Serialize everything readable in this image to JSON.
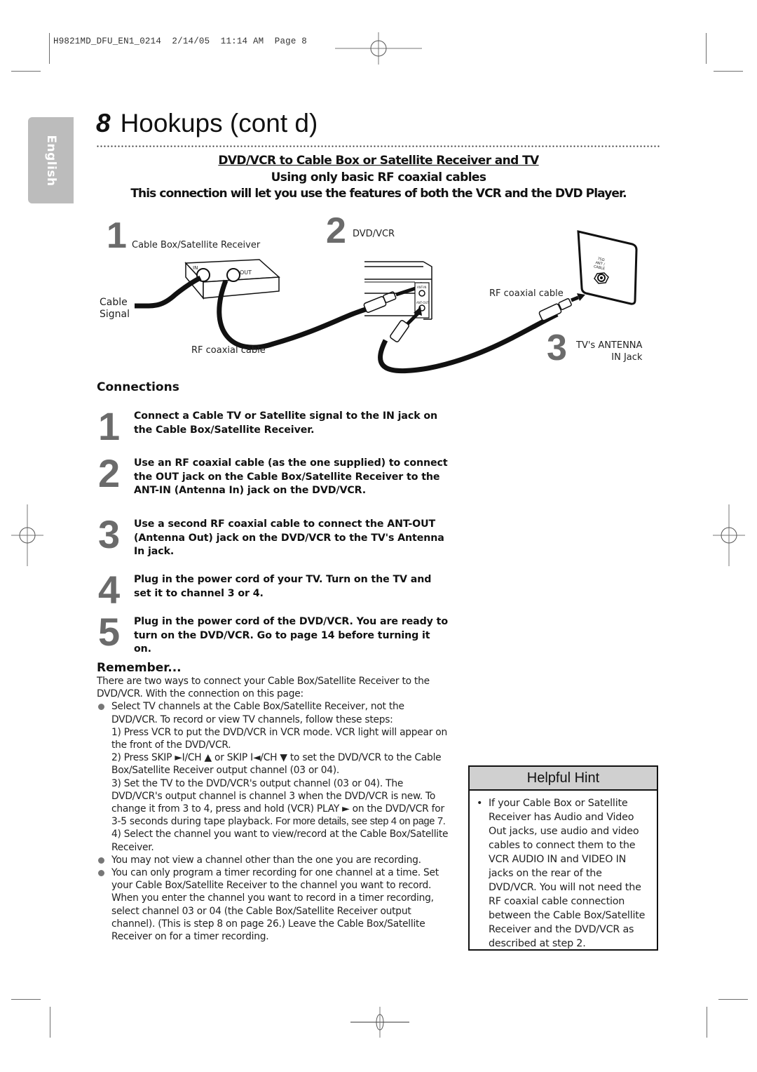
{
  "print_slug": "H9821MD_DFU_EN1_0214  2/14/05  11:14 AM  Page 8",
  "language_tab": "English",
  "header": {
    "page_number": "8",
    "title": "Hookups (cont d)",
    "subtitle_1": "DVD/VCR to Cable Box or Satellite Receiver and TV",
    "subtitle_2": "Using only basic RF coaxial cables",
    "subtitle_3": "This connection will let you use the features of both the VCR and the DVD Player."
  },
  "diagram": {
    "step1_number": "1",
    "step1_label": "Cable Box/Satellite Receiver",
    "step2_number": "2",
    "step2_label": "DVD/VCR",
    "step3_number": "3",
    "step3_label_line1": "TV's ANTENNA",
    "step3_label_line2": "IN Jack",
    "cable_signal_line1": "Cable",
    "cable_signal_line2": "Signal",
    "rf_cable_label_1": "RF coaxial cable",
    "rf_cable_label_2": "RF coaxial cable",
    "box_in_label": "IN",
    "box_out_label": "OUT",
    "vcr_ant_in": "ANT-IN",
    "vcr_ant_out": "ANT-OUT",
    "tv_jack_label": [
      "75Ω",
      "ANT /",
      "CABLE"
    ]
  },
  "connections": {
    "heading": "Connections",
    "steps": [
      {
        "number": "1",
        "text": "Connect a Cable TV or Satellite signal to the IN jack on the Cable Box/Satellite Receiver."
      },
      {
        "number": "2",
        "text": "Use an RF coaxial cable (as the one supplied) to connect the OUT jack on the Cable Box/Satellite Receiver to the ANT-IN (Antenna In) jack on the DVD/VCR."
      },
      {
        "number": "3",
        "text": "Use a second RF coaxial cable to connect the ANT-OUT (Antenna Out) jack on the DVD/VCR to the TV's Antenna In jack."
      },
      {
        "number": "4",
        "text": "Plug in the power cord of your TV. Turn on the TV and set it to channel 3 or 4."
      },
      {
        "number": "5",
        "text": "Plug in the power cord of the DVD/VCR. You are ready to turn on the DVD/VCR. Go to page 14 before turning it on."
      }
    ]
  },
  "remember": {
    "heading": "Remember...",
    "intro": "There are two ways to connect your Cable Box/Satellite Receiver to the DVD/VCR. With the connection on this page:",
    "bullet_1": "Select TV channels at the Cable Box/Satellite Receiver, not the DVD/VCR. To record or view TV channels, follow these steps:",
    "sub_1": "1) Press VCR to put the DVD/VCR in VCR mode. VCR light will appear on the front of the DVD/VCR.",
    "sub_2": "2) Press SKIP ►I/CH ▲ or SKIP I◄/CH ▼ to set the DVD/VCR to the Cable Box/Satellite Receiver output channel (03 or 04).",
    "sub_3a": "3) Set the TV to the DVD/VCR's output channel (03 or 04). The DVD/VCR's output channel is channel 3 when the DVD/VCR is new. To change it from 3 to 4, press and hold (VCR) PLAY ► on the DVD/VCR for 3-5 seconds during tape playback.",
    "sub_3b": " For more details, see step 4 on page 7.",
    "sub_4": "4) Select the channel you want to view/record at the Cable Box/Satellite Receiver.",
    "bullet_2": "You may not view a channel other than the one you are recording.",
    "bullet_3": "You can only program a timer recording for one channel at a time. Set your Cable Box/Satellite Receiver to the channel you want to record. When you enter the channel you want to record in a timer recording, select channel 03 or 04 (the Cable Box/Satellite Receiver output channel). (This is step 8 on page 26.) Leave the Cable Box/Satellite Receiver on for a timer recording."
  },
  "helpful_hint": {
    "heading": "Helpful Hint",
    "text": "If your Cable Box or Satellite Receiver has Audio and Video Out jacks, use audio and video cables to connect them to the VCR AUDIO IN and VIDEO IN jacks on the rear of the DVD/VCR. You will not need the RF coaxial cable connection between the Cable Box/Satellite Receiver and the DVD/VCR as described at step 2."
  }
}
